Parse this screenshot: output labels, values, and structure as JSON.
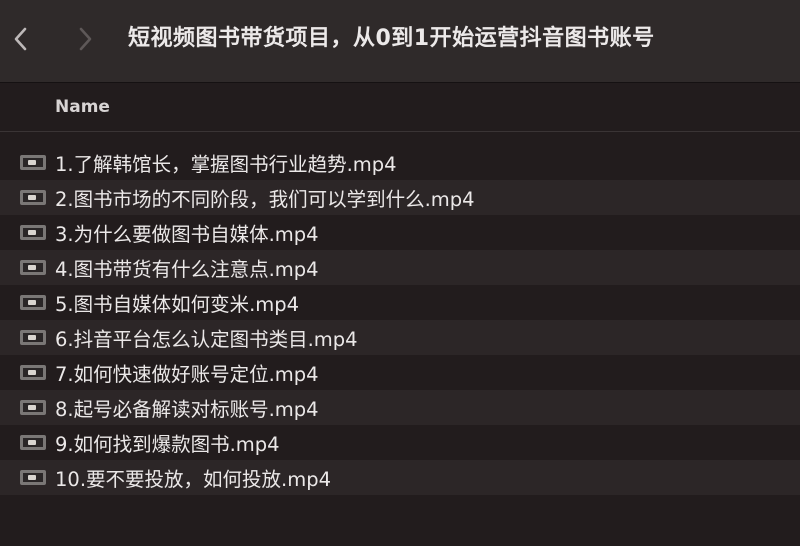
{
  "window": {
    "title": "短视频图书带货项目，从0到1开始运营抖音图书账号"
  },
  "toolbar": {
    "back_icon": "chevron-left-icon",
    "forward_icon": "chevron-right-icon"
  },
  "columns": {
    "name": "Name"
  },
  "files": [
    {
      "name": "1.了解韩馆长，掌握图书行业趋势.mp4",
      "icon": "video-file-icon"
    },
    {
      "name": "2.图书市场的不同阶段，我们可以学到什么.mp4",
      "icon": "video-file-icon"
    },
    {
      "name": "3.为什么要做图书自媒体.mp4",
      "icon": "video-file-icon"
    },
    {
      "name": "4.图书带货有什么注意点.mp4",
      "icon": "video-file-icon"
    },
    {
      "name": "5.图书自媒体如何变米.mp4",
      "icon": "video-file-icon"
    },
    {
      "name": "6.抖音平台怎么认定图书类目.mp4",
      "icon": "video-file-icon"
    },
    {
      "name": "7.如何快速做好账号定位.mp4",
      "icon": "video-file-icon"
    },
    {
      "name": "8.起号必备解读对标账号.mp4",
      "icon": "video-file-icon"
    },
    {
      "name": "9.如何找到爆款图书.mp4",
      "icon": "video-file-icon"
    },
    {
      "name": "10.要不要投放，如何投放.mp4",
      "icon": "video-file-icon"
    }
  ]
}
